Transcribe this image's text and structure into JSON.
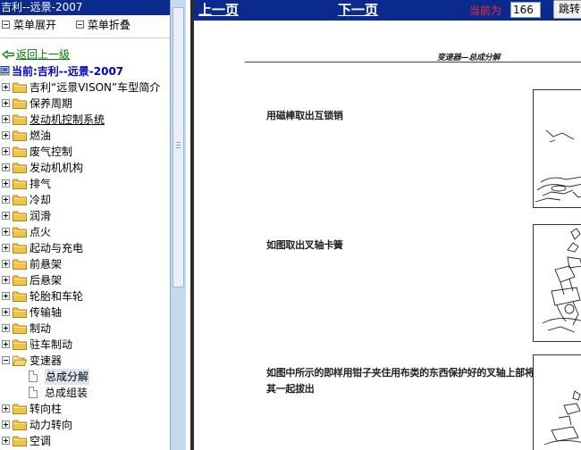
{
  "left_panel": {
    "title": "吉利--远景-2007",
    "menu": {
      "expand_label": "菜单展开",
      "collapse_label": "菜单折叠"
    },
    "back_label": "返回上一级",
    "current_label": "当前:吉利--远景-2007",
    "tree": [
      {
        "label": "吉利“远景VISON”车型简介"
      },
      {
        "label": "保养周期"
      },
      {
        "label": "发动机控制系统"
      },
      {
        "label": "燃油"
      },
      {
        "label": "废气控制"
      },
      {
        "label": "发动机机构"
      },
      {
        "label": "排气"
      },
      {
        "label": "冷却"
      },
      {
        "label": "润滑"
      },
      {
        "label": "点火"
      },
      {
        "label": "起动与充电"
      },
      {
        "label": "前悬架"
      },
      {
        "label": "后悬架"
      },
      {
        "label": "轮胎和车轮"
      },
      {
        "label": "传输轴"
      },
      {
        "label": "制动"
      },
      {
        "label": "驻车制动"
      },
      {
        "label": "变速器",
        "expanded": true,
        "children": [
          {
            "label": "总成分解",
            "selected": true
          },
          {
            "label": "总成组装"
          }
        ]
      },
      {
        "label": "转向柱"
      },
      {
        "label": "动力转向"
      },
      {
        "label": "空调"
      }
    ]
  },
  "toolbar": {
    "prev_label": "上一页",
    "next_label": "下一页",
    "current_label": "当前为",
    "page_value": "166",
    "jump_label": "跳转"
  },
  "document": {
    "header": "变速器—总成分解",
    "steps": [
      {
        "text": "用磁棒取出互锁销"
      },
      {
        "text": "如图取出叉轴卡簧"
      },
      {
        "text": "如图中所示的即样用钳子夹住用布类的东西保护好的叉轴上部将其一起拔出"
      }
    ]
  },
  "colors": {
    "title_bar": "#0b2a8e",
    "current_label": "#ff2a2a",
    "back_link": "#007a00",
    "current_node": "#0000cc",
    "folder": "#f3c24c"
  }
}
